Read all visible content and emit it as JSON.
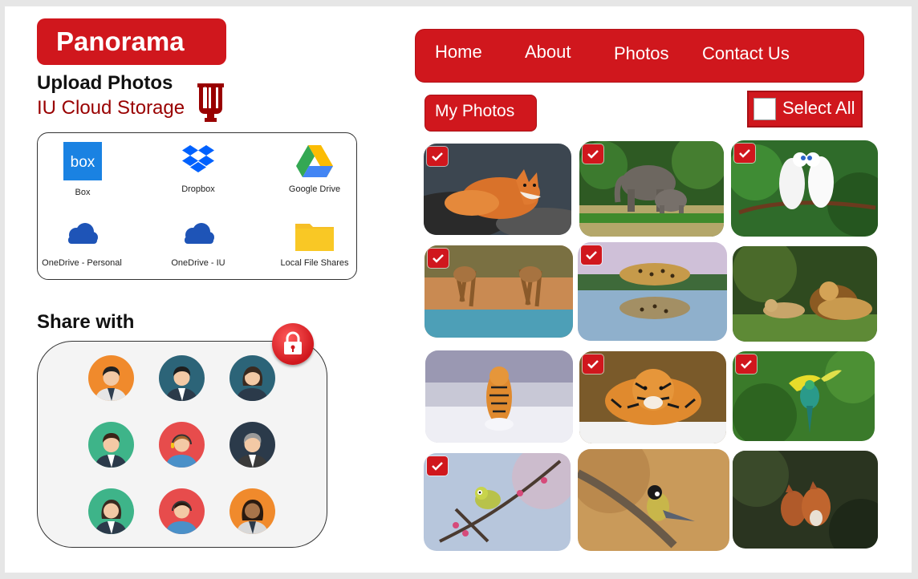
{
  "app": {
    "title": "Panorama"
  },
  "upload": {
    "title": "Upload Photos",
    "storage_title": "IU Cloud Storage",
    "services": [
      {
        "label": "Box",
        "icon": "box-icon"
      },
      {
        "label": "Dropbox",
        "icon": "dropbox-icon"
      },
      {
        "label": "Google Drive",
        "icon": "google-drive-icon"
      },
      {
        "label": "OneDrive - Personal",
        "icon": "onedrive-icon"
      },
      {
        "label": "OneDrive - IU",
        "icon": "onedrive-icon"
      },
      {
        "label": "Local File Shares",
        "icon": "folder-icon"
      }
    ]
  },
  "share": {
    "title": "Share with"
  },
  "nav": {
    "items": [
      "Home",
      "About",
      "Photos",
      "Contact Us"
    ]
  },
  "photos": {
    "section_label": "My Photos",
    "select_all_label": "Select All",
    "items": [
      {
        "subject": "red fox",
        "checked": true
      },
      {
        "subject": "elephants",
        "checked": true
      },
      {
        "subject": "white birds",
        "checked": true
      },
      {
        "subject": "giraffes",
        "checked": true
      },
      {
        "subject": "leopard",
        "checked": true
      },
      {
        "subject": "lions",
        "checked": false
      },
      {
        "subject": "tiger in snow",
        "checked": false
      },
      {
        "subject": "tiger",
        "checked": true
      },
      {
        "subject": "hummingbird",
        "checked": true
      },
      {
        "subject": "white-eye bird",
        "checked": true
      },
      {
        "subject": "great tit",
        "checked": false
      },
      {
        "subject": "fox cubs",
        "checked": false
      }
    ]
  },
  "colors": {
    "accent": "#d0171d",
    "iu_crimson": "#990000"
  }
}
